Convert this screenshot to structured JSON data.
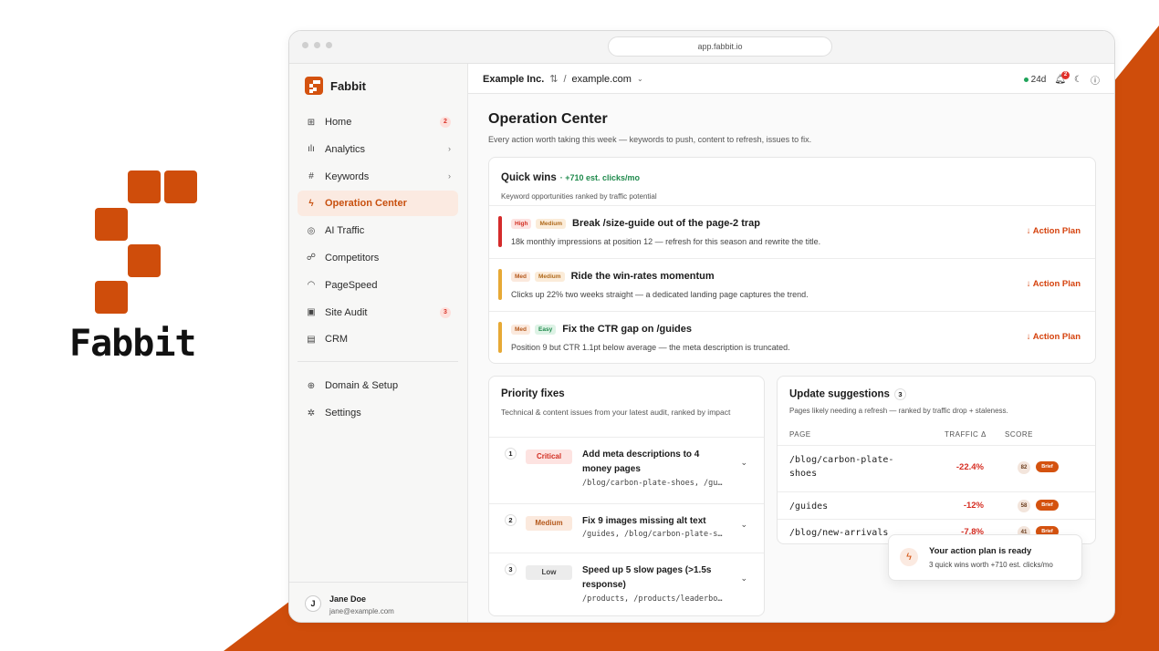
{
  "brand": {
    "name": "Fabbit",
    "accent_color": "#d4520f"
  },
  "browser": {
    "url": "app.fabbit.io"
  },
  "sidebar": {
    "brand_name": "Fabbit",
    "items": [
      {
        "label": "Home",
        "icon": "grid-icon",
        "badge": "2"
      },
      {
        "label": "Analytics",
        "icon": "bar-chart-icon",
        "chevron": "›"
      },
      {
        "label": "Keywords",
        "icon": "hash-icon",
        "chevron": "›"
      },
      {
        "label": "Operation Center",
        "icon": "bolt-icon",
        "active": true
      },
      {
        "label": "AI Traffic",
        "icon": "target-icon"
      },
      {
        "label": "Competitors",
        "icon": "users-icon"
      },
      {
        "label": "PageSpeed",
        "icon": "gauge-icon"
      },
      {
        "label": "Site Audit",
        "icon": "clipboard-icon",
        "badge": "3"
      },
      {
        "label": "CRM",
        "icon": "id-card-icon"
      }
    ],
    "footer_items": [
      {
        "label": "Domain & Setup",
        "icon": "globe-icon"
      },
      {
        "label": "Settings",
        "icon": "gear-icon"
      }
    ],
    "user": {
      "initial": "J",
      "name": "Jane Doe",
      "email": "jane@example.com"
    }
  },
  "topbar": {
    "org": "Example Inc.",
    "switch_icon": "⇅",
    "separator": "/",
    "domain": "example.com",
    "days": "24d",
    "notif_count": "2"
  },
  "page": {
    "title": "Operation Center",
    "subtitle": "Every action worth taking this week — keywords to push, content to refresh, issues to fix."
  },
  "quick_wins": {
    "title": "Quick wins",
    "gain": "· +710 est. clicks/mo",
    "subtitle": "Keyword opportunities ranked by traffic potential",
    "action_label": "↓ Action Plan",
    "items": [
      {
        "bar_color": "#d42b2b",
        "tag1": "High",
        "tag2": "Medium",
        "title": "Break /size-guide out of the page-2 trap",
        "desc": "18k monthly impressions at position 12 — refresh for this season and rewrite the title."
      },
      {
        "bar_color": "#e7a935",
        "tag1": "Med",
        "tag2": "Medium",
        "title": "Ride the win-rates momentum",
        "desc": "Clicks up 22% two weeks straight — a dedicated landing page captures the trend."
      },
      {
        "bar_color": "#e7a935",
        "tag1": "Med",
        "tag2": "Easy",
        "title": "Fix the CTR gap on /guides",
        "desc": "Position 9 but CTR 1.1pt below average — the meta description is truncated."
      }
    ]
  },
  "priority_fixes": {
    "title": "Priority fixes",
    "subtitle": "Technical & content issues from your latest audit, ranked by impact",
    "items": [
      {
        "num": "1",
        "severity": "Critical",
        "title": "Add meta descriptions to 4 money pages",
        "path": "/blog/carbon-plate-shoes, /gu…"
      },
      {
        "num": "2",
        "severity": "Medium",
        "title": "Fix 9 images missing alt text",
        "path": "/guides, /blog/carbon-plate-s…"
      },
      {
        "num": "3",
        "severity": "Low",
        "title": "Speed up 5 slow pages (>1.5s response)",
        "path": "/products, /products/leaderbo…"
      }
    ]
  },
  "update_suggestions": {
    "title": "Update suggestions",
    "count": "3",
    "subtitle": "Pages likely needing a refresh — ranked by traffic drop + staleness.",
    "headers": {
      "page": "PAGE",
      "traffic": "TRAFFIC Δ",
      "score": "SCORE"
    },
    "brief_label": "Brief",
    "rows": [
      {
        "page": "/blog/carbon-plate-shoes",
        "traffic": "-22.4%",
        "score": "82"
      },
      {
        "page": "/guides",
        "traffic": "-12%",
        "score": "58"
      },
      {
        "page": "/blog/new-arrivals",
        "traffic": "-7.8%",
        "score": "41"
      }
    ]
  },
  "toast": {
    "title": "Your action plan is ready",
    "subtitle": "3 quick wins worth +710 est. clicks/mo"
  }
}
